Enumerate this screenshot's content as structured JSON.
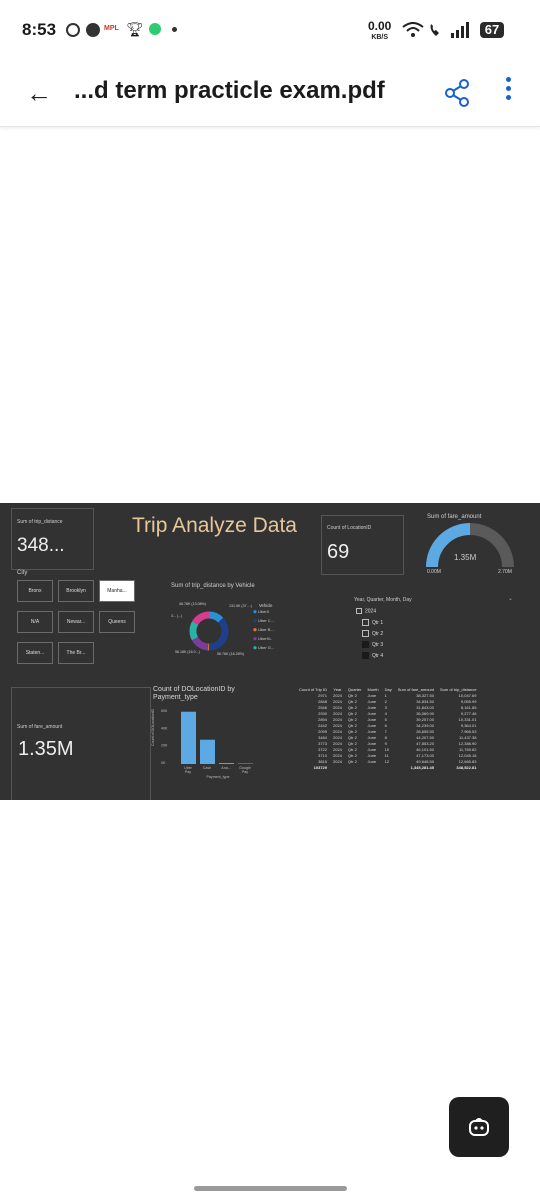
{
  "status_bar": {
    "time": "8:53",
    "app_badge": "MPL",
    "net_speed": "0.00",
    "net_unit": "KB/S",
    "battery": "67"
  },
  "app_bar": {
    "title": "...d term practicle exam.pdf"
  },
  "dashboard": {
    "title": "Trip Analyze Data",
    "kpi_trip_distance": {
      "label": "Sum of trip_distance",
      "value": "348..."
    },
    "kpi_location_count": {
      "label": "Count of LocationID",
      "value": "69"
    },
    "gauge": {
      "label": "Sum of fare_amount",
      "value": "1.35M",
      "min": "0.00M",
      "max": "2.70M",
      "fraction": 0.5
    },
    "kpi_fare": {
      "label": "Sum of fare_amount",
      "value": "1.35M"
    },
    "city_slicer": {
      "label": "City",
      "items": [
        "Bronx",
        "Brooklyn",
        "Manha...",
        "N/A",
        "Newar...",
        "Queens",
        "Staten...",
        "The Br..."
      ],
      "selected_index": 2
    },
    "donut": {
      "title": "Sum of trip_distance by Vehicle",
      "legend_title": "Vehicle",
      "legend": [
        "UberX",
        "Uber C...",
        "Uber B...",
        "UberXL",
        "Uber G..."
      ],
      "labels": [
        "46.78K (13.08%)",
        "131.5K (37....)",
        "3... (...)",
        "56.18K (16.0...)",
        "56.78K (16.28%)"
      ],
      "colors": [
        "#2b8fd6",
        "#1f3f8a",
        "#e07a2e",
        "#7a3d9a",
        "#2bb0a5",
        "#d63c8e"
      ]
    },
    "date_slicer": {
      "label": "Year, Quarter, Month, Day",
      "year": "2024",
      "quarters": [
        "Qtr 1",
        "Qtr 2",
        "Qtr 3",
        "Qtr 4"
      ],
      "checked": [
        false,
        false,
        true,
        true
      ]
    },
    "bar_chart": {
      "title": "Count of DOLocationID by Payment_type",
      "xlabel": "Payment_type",
      "ylabel": "Count of DOLocationID",
      "ticks": [
        "60K",
        "40K",
        "20K",
        "0K"
      ],
      "categories": [
        "Uber Pay",
        "Cash",
        "Ana...",
        "Google Pay"
      ],
      "values": [
        56000,
        26000,
        1000,
        500
      ],
      "ylim": [
        0,
        60000
      ],
      "color": "#5da9e3"
    },
    "table": {
      "headers": [
        "Count of Trip ID",
        "Year",
        "Quarter",
        "Month",
        "Day",
        "Sum of fare_amount",
        "Sum of trip_distance"
      ],
      "rows": [
        [
          "2971",
          "2024",
          "Qtr 2",
          "June",
          "1",
          "38,327.50",
          "10,047.69"
        ],
        [
          "2848",
          "2024",
          "Qtr 2",
          "June",
          "2",
          "34,834.50",
          "9,055.99"
        ],
        [
          "2546",
          "2024",
          "Qtr 2",
          "June",
          "3",
          "31,843.00",
          "8,161.85"
        ],
        [
          "2930",
          "2024",
          "Qtr 2",
          "June",
          "4",
          "36,069.90",
          "9,277.46"
        ],
        [
          "2894",
          "2024",
          "Qtr 2",
          "June",
          "5",
          "39,257.00",
          "10,331.01"
        ],
        [
          "2442",
          "2024",
          "Qtr 2",
          "June",
          "6",
          "34,239.00",
          "9,364.01"
        ],
        [
          "2099",
          "2024",
          "Qtr 2",
          "June",
          "7",
          "28,655.50",
          "7,966.53"
        ],
        [
          "3484",
          "2024",
          "Qtr 2",
          "June",
          "8",
          "44,207.50",
          "11,437.38"
        ],
        [
          "3773",
          "2024",
          "Qtr 2",
          "June",
          "9",
          "47,853.20",
          "12,388.90"
        ],
        [
          "3722",
          "2024",
          "Qtr 2",
          "June",
          "10",
          "46,101.50",
          "11,769.62"
        ],
        [
          "3710",
          "2024",
          "Qtr 2",
          "June",
          "11",
          "47,173.00",
          "12,045.18"
        ],
        [
          "3815",
          "2024",
          "Qtr 2",
          "June",
          "12",
          "49,646.50",
          "12,665.83"
        ]
      ],
      "total": [
        "103729",
        "",
        "",
        "",
        "",
        "1,345,281.45",
        "348,522.81"
      ]
    }
  }
}
